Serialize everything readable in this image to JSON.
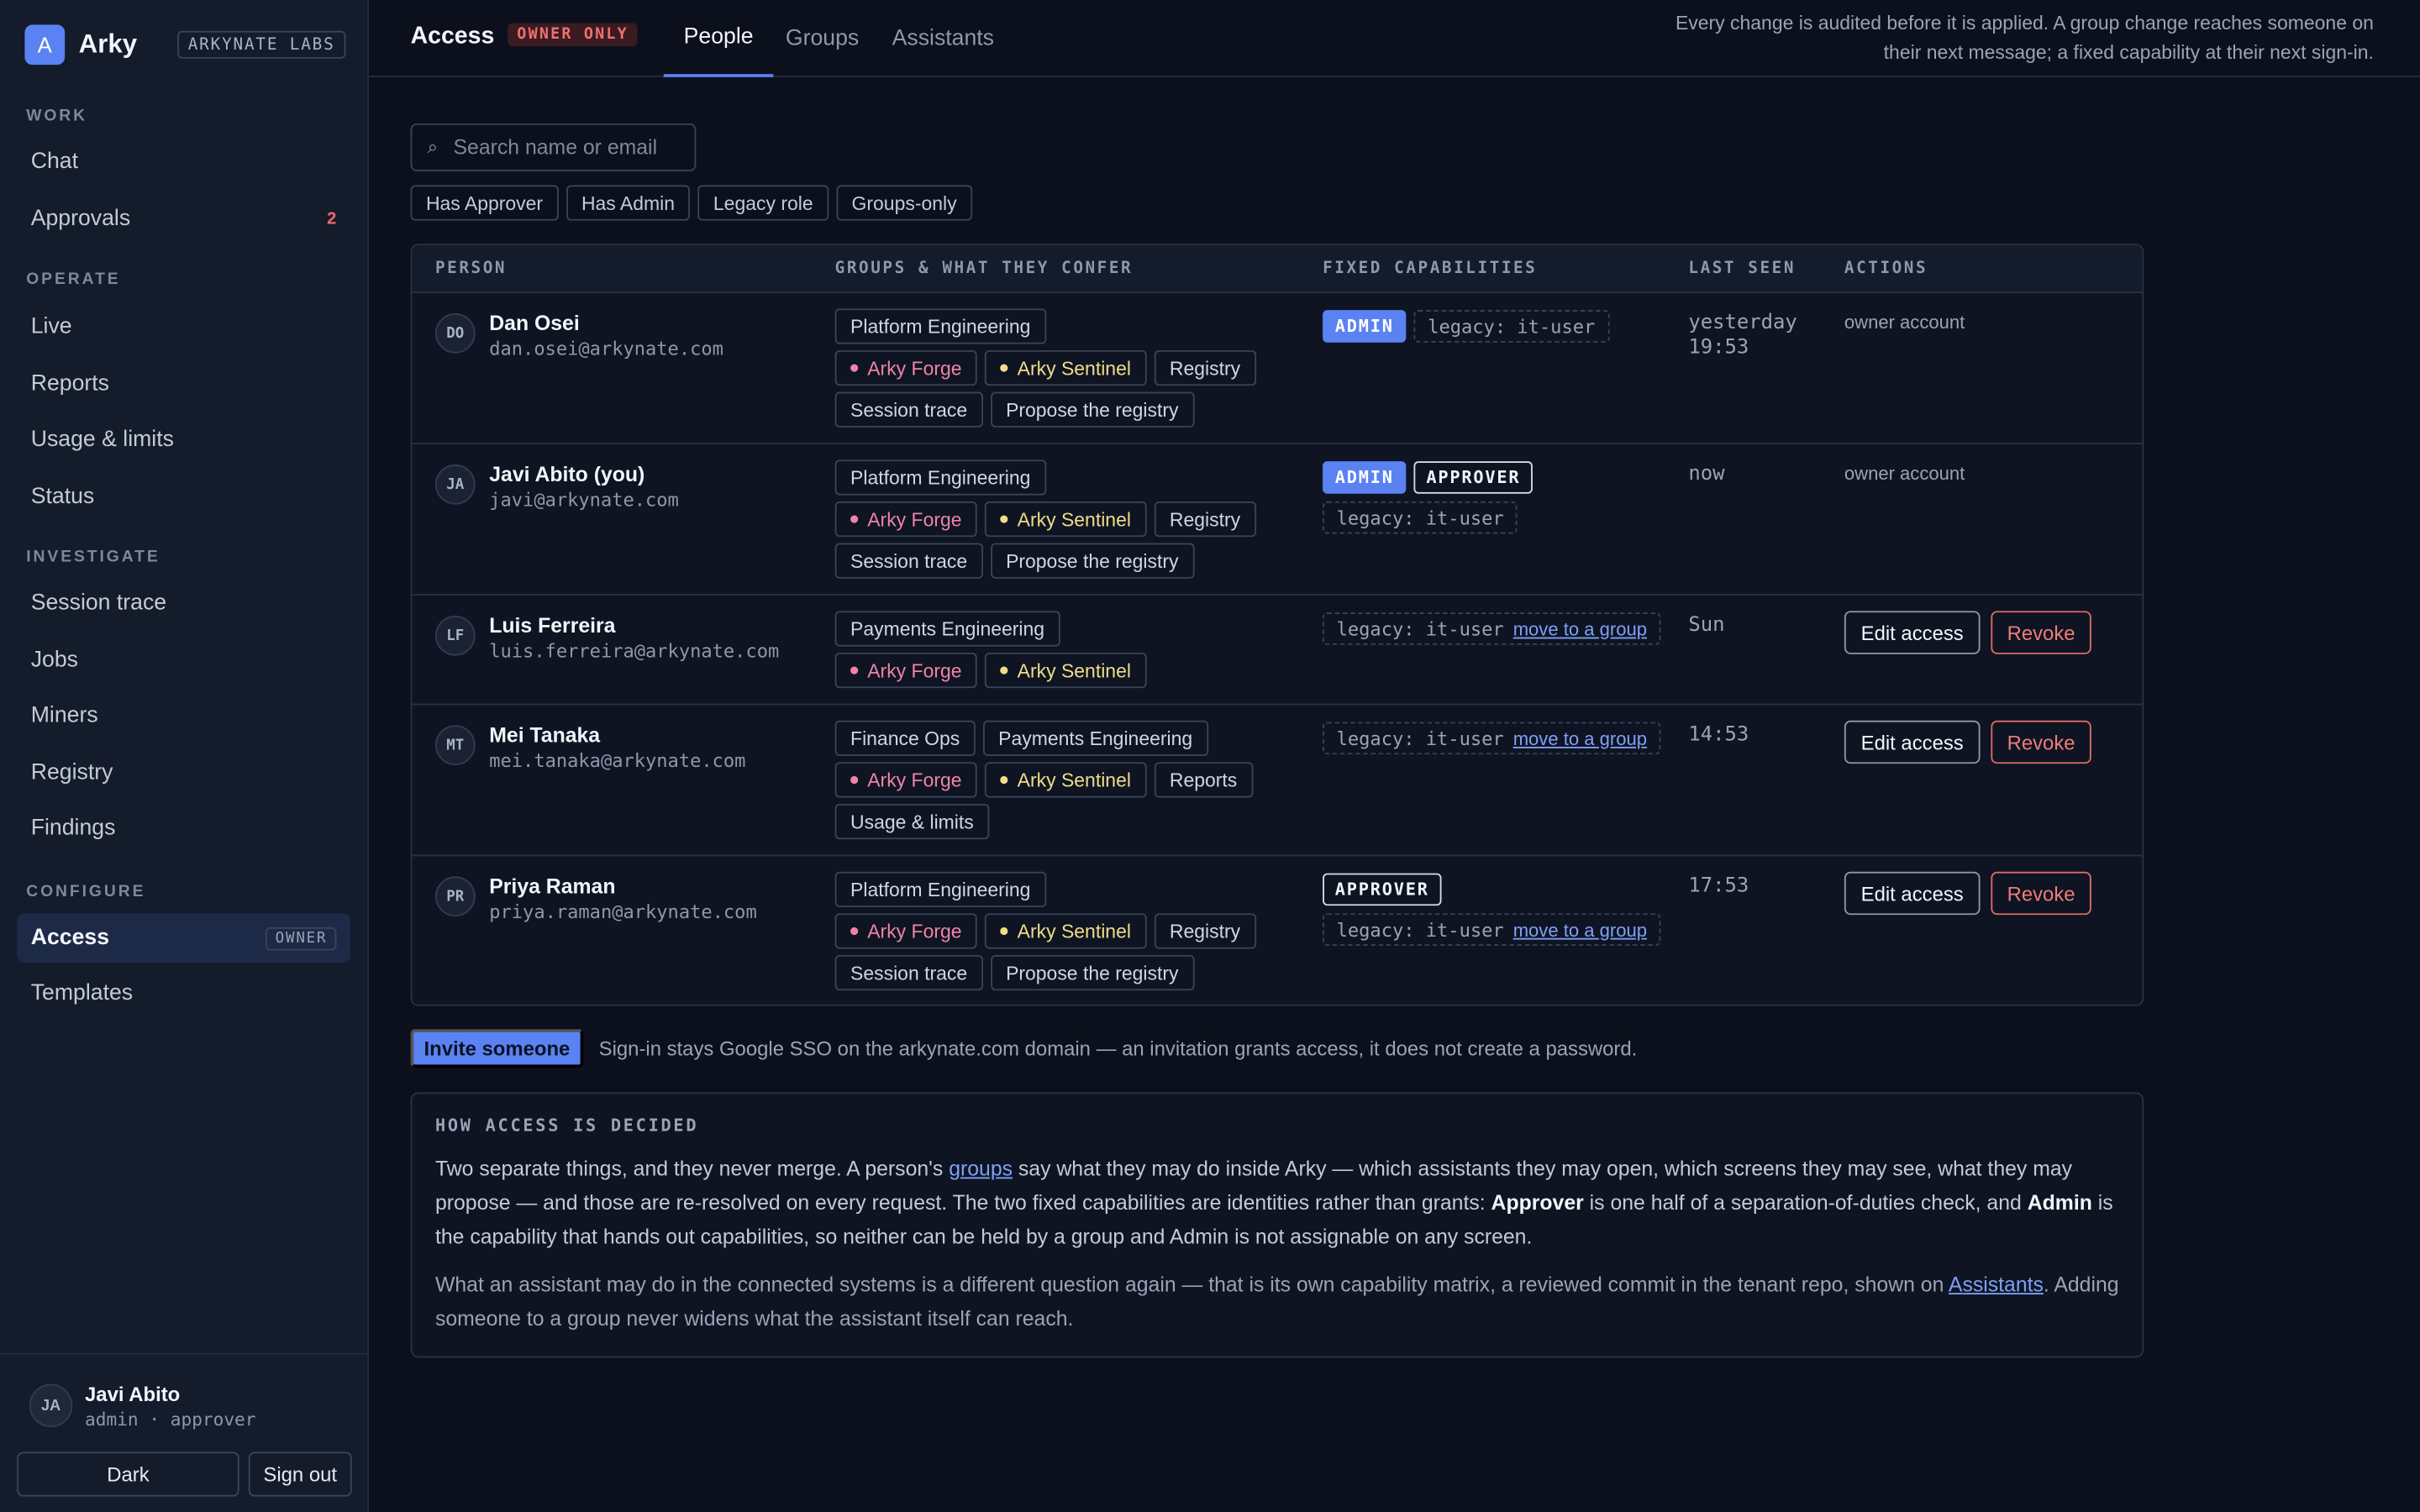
{
  "brand": {
    "logo_letter": "A",
    "name": "Arky",
    "org": "ARKYNATE LABS"
  },
  "sidebar": {
    "sections": {
      "work": "WORK",
      "operate": "OPERATE",
      "investigate": "INVESTIGATE",
      "configure": "CONFIGURE"
    },
    "items": {
      "chat": "Chat",
      "approvals": "Approvals",
      "approvals_count": "2",
      "live": "Live",
      "reports": "Reports",
      "usage": "Usage & limits",
      "status": "Status",
      "session_trace": "Session trace",
      "jobs": "Jobs",
      "miners": "Miners",
      "registry": "Registry",
      "findings": "Findings",
      "access": "Access",
      "access_badge": "OWNER",
      "templates": "Templates"
    },
    "user": {
      "initials": "JA",
      "name": "Javi Abito",
      "role": "admin · approver"
    },
    "theme_button": "Dark",
    "signout_button": "Sign out"
  },
  "header": {
    "title": "Access",
    "badge": "OWNER ONLY",
    "tabs": [
      "People",
      "Groups",
      "Assistants"
    ],
    "active_tab": "People",
    "note": "Every change is audited before it is applied. A group change reaches someone on their next message; a fixed capability at their next sign-in."
  },
  "search": {
    "placeholder": "Search name or email",
    "value": ""
  },
  "filters": [
    "Has Approver",
    "Has Admin",
    "Legacy role",
    "Groups-only"
  ],
  "table": {
    "headers": {
      "person": "PERSON",
      "groups": "GROUPS & WHAT THEY CONFER",
      "caps": "FIXED CAPABILITIES",
      "seen": "LAST SEEN",
      "actions": "ACTIONS"
    },
    "legacy_label": "legacy: it-user",
    "move_link": "move to a group",
    "owner_account": "owner account",
    "edit_label": "Edit access",
    "revoke_label": "Revoke",
    "admin_badge": "ADMIN",
    "approver_badge": "APPROVER",
    "rows": [
      {
        "initials": "DO",
        "name": "Dan Osei",
        "email": "dan.osei@arkynate.com",
        "groups": [
          "Platform Engineering"
        ],
        "assistants": [
          "Arky Forge",
          "Arky Sentinel"
        ],
        "screens": [
          "Registry",
          "Session trace",
          "Propose the registry"
        ],
        "last_seen": "yesterday 19:53"
      },
      {
        "initials": "JA",
        "name": "Javi Abito (you)",
        "email": "javi@arkynate.com",
        "groups": [
          "Platform Engineering"
        ],
        "assistants": [
          "Arky Forge",
          "Arky Sentinel"
        ],
        "screens": [
          "Registry",
          "Session trace",
          "Propose the registry"
        ],
        "last_seen": "now"
      },
      {
        "initials": "LF",
        "name": "Luis Ferreira",
        "email": "luis.ferreira@arkynate.com",
        "groups": [
          "Payments Engineering"
        ],
        "assistants": [
          "Arky Forge",
          "Arky Sentinel"
        ],
        "screens": [],
        "last_seen": "Sun"
      },
      {
        "initials": "MT",
        "name": "Mei Tanaka",
        "email": "mei.tanaka@arkynate.com",
        "groups": [
          "Finance Ops",
          "Payments Engineering"
        ],
        "assistants": [
          "Arky Forge",
          "Arky Sentinel"
        ],
        "screens": [
          "Reports",
          "Usage & limits"
        ],
        "last_seen": "14:53"
      },
      {
        "initials": "PR",
        "name": "Priya Raman",
        "email": "priya.raman@arkynate.com",
        "groups": [
          "Platform Engineering"
        ],
        "assistants": [
          "Arky Forge",
          "Arky Sentinel"
        ],
        "screens": [
          "Registry",
          "Session trace",
          "Propose the registry"
        ],
        "last_seen": "17:53"
      }
    ]
  },
  "invite": {
    "button": "Invite someone",
    "note": "Sign-in stays Google SSO on the arkynate.com domain — an invitation grants access, it does not create a password."
  },
  "how": {
    "title": "HOW ACCESS IS DECIDED",
    "p1_a": "Two separate things, and they never merge. A person's ",
    "p1_link": "groups",
    "p1_b": " say what they may do inside Arky — which assistants they may open, which screens they may see, what they may propose — and those are re-resolved on every request. The two fixed capabilities are identities rather than grants: ",
    "p1_approver": "Approver",
    "p1_c": " is one half of a separation-of-duties check, and ",
    "p1_admin": "Admin",
    "p1_d": " is the capability that hands out capabilities, so neither can be held by a group and Admin is not assignable on any screen.",
    "p2_a": "What an assistant may do in the connected systems is a different question again — that is its own capability matrix, a reviewed commit in the tenant repo, shown on ",
    "p2_link": "Assistants",
    "p2_b": ". Adding someone to a group never widens what the assistant itself can reach."
  },
  "colors": {
    "accent": "#5b82f3",
    "forge": "#f083a8",
    "sentinel": "#f0dd87",
    "danger": "#ef6b6b"
  }
}
